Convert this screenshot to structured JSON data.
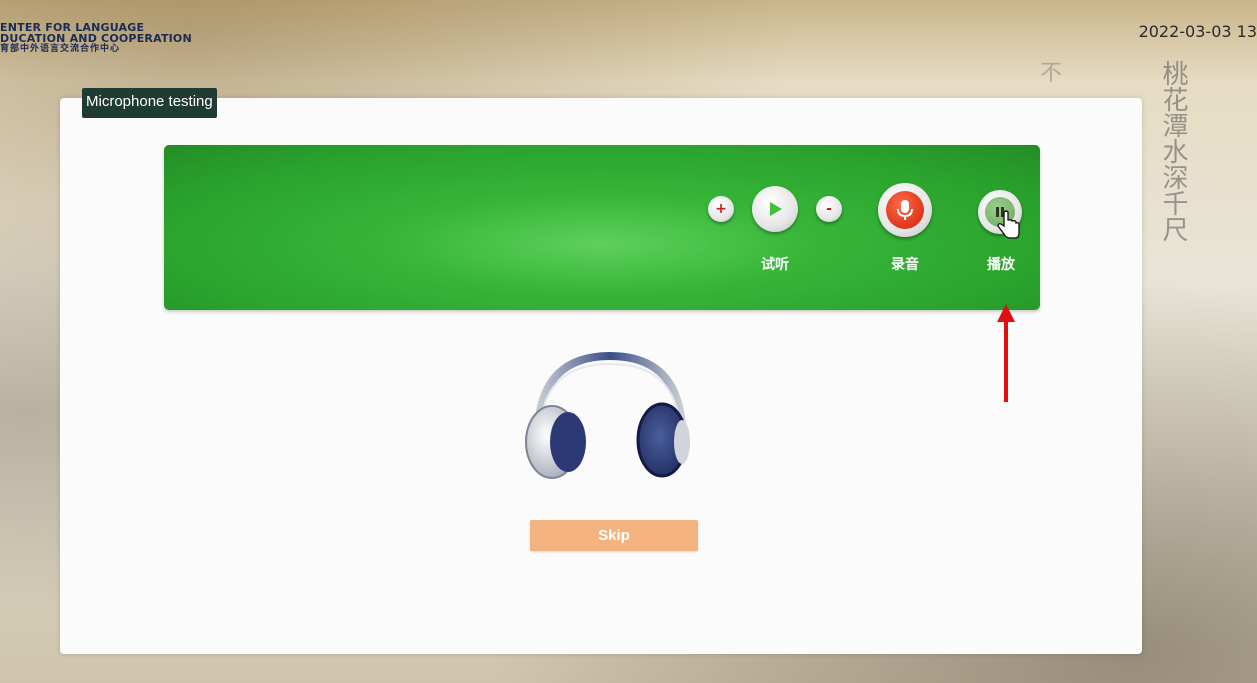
{
  "header": {
    "logo_line1": "ENTER FOR LANGUAGE",
    "logo_line2": "DUCATION AND COOPERATION",
    "logo_line3": "育部中外语言交流合作中心",
    "datetime": "2022-03-03 13"
  },
  "background": {
    "calligraphy_right": "桃花潭水深千尺",
    "calligraphy_left": "不"
  },
  "dialog": {
    "title": "Microphone testing"
  },
  "controls": {
    "volume_up": "+",
    "volume_down": "-",
    "listen_label": "试听",
    "record_label": "录音",
    "play_label": "播放"
  },
  "skip_button": {
    "label": "Skip"
  },
  "colors": {
    "green_bar": "#2aa12c",
    "title_tab": "#1f3b33",
    "skip_button": "#f3b27e",
    "record_red": "#e0361b",
    "arrow_red": "#e01010"
  },
  "icons": [
    "plus-icon",
    "play-icon",
    "minus-icon",
    "microphone-icon",
    "pause-icon",
    "cursor-icon",
    "arrow-up-icon",
    "headphones-icon"
  ]
}
